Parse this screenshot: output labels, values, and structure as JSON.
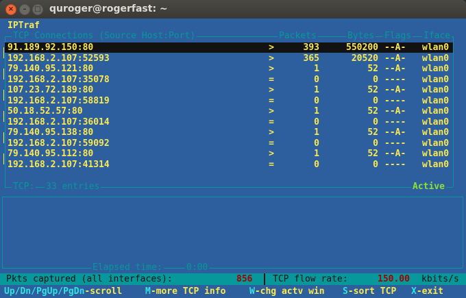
{
  "window": {
    "title": "quroger@rogerfast: ~",
    "close_glyph": "×",
    "min_glyph": "–",
    "max_glyph": "□"
  },
  "app": {
    "name": "IPTraf"
  },
  "tcp": {
    "header": {
      "connections": "TCP Connections (Source Host:Port)",
      "packets": "Packets",
      "bytes": "Bytes",
      "flags": "Flags",
      "iface": "Iface"
    },
    "rows": [
      {
        "host": "91.189.92.150:80",
        "dir": ">",
        "packets": "393",
        "bytes": "550200",
        "flags": "--A-",
        "iface": "wlan0"
      },
      {
        "host": "192.168.2.107:52593",
        "dir": ">",
        "packets": "365",
        "bytes": "20520",
        "flags": "--A-",
        "iface": "wlan0"
      },
      {
        "host": "79.140.95.121:80",
        "dir": ">",
        "packets": "1",
        "bytes": "52",
        "flags": "--A-",
        "iface": "wlan0"
      },
      {
        "host": "192.168.2.107:35078",
        "dir": "=",
        "packets": "0",
        "bytes": "0",
        "flags": "----",
        "iface": "wlan0"
      },
      {
        "host": "107.23.72.189:80",
        "dir": ">",
        "packets": "1",
        "bytes": "52",
        "flags": "--A-",
        "iface": "wlan0"
      },
      {
        "host": "192.168.2.107:58819",
        "dir": "=",
        "packets": "0",
        "bytes": "0",
        "flags": "----",
        "iface": "wlan0"
      },
      {
        "host": "50.18.52.57:80",
        "dir": ">",
        "packets": "1",
        "bytes": "52",
        "flags": "--A-",
        "iface": "wlan0"
      },
      {
        "host": "192.168.2.107:36014",
        "dir": "=",
        "packets": "0",
        "bytes": "0",
        "flags": "----",
        "iface": "wlan0"
      },
      {
        "host": "79.140.95.138:80",
        "dir": ">",
        "packets": "1",
        "bytes": "52",
        "flags": "--A-",
        "iface": "wlan0"
      },
      {
        "host": "192.168.2.107:59092",
        "dir": "=",
        "packets": "0",
        "bytes": "0",
        "flags": "----",
        "iface": "wlan0"
      },
      {
        "host": "79.140.95.112:80",
        "dir": ">",
        "packets": "1",
        "bytes": "52",
        "flags": "--A-",
        "iface": "wlan0"
      },
      {
        "host": "192.168.2.107:41314",
        "dir": "=",
        "packets": "0",
        "bytes": "0",
        "flags": "----",
        "iface": "wlan0"
      }
    ],
    "footer_label": "TCP:",
    "footer_entries": "33 entries",
    "status": "Active"
  },
  "other": {
    "elapsed_label": "Elapsed time:",
    "elapsed_value": "0:00"
  },
  "statusbar": {
    "pkts_label": "Pkts captured (all interfaces):",
    "pkts_value": "856",
    "rate_label": "TCP flow rate:",
    "rate_value": "150.00",
    "rate_unit": "kbits/s"
  },
  "help": [
    {
      "key": "Up/Dn/PgUp/PgDn",
      "desc": "-scroll"
    },
    {
      "key": "M",
      "desc": "-more TCP info"
    },
    {
      "key": "W",
      "desc": "-chg actv win"
    },
    {
      "key": "S",
      "desc": "-sort TCP"
    },
    {
      "key": "X",
      "desc": "-exit"
    }
  ],
  "colors": {
    "background": "#2d5f9e",
    "highlight": "#fce94f",
    "border": "#06989a",
    "active": "#8ae234"
  }
}
